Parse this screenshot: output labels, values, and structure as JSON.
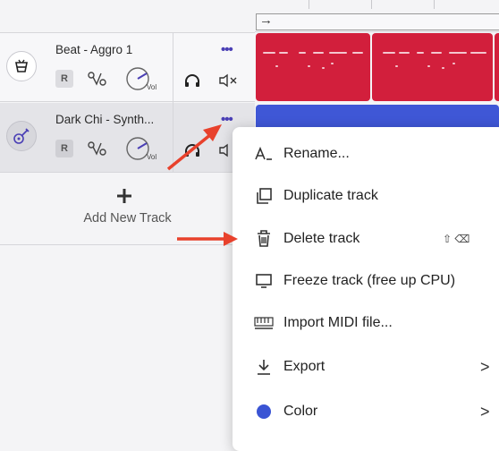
{
  "tracks": [
    {
      "name": "Beat - Aggro 1",
      "record_label": "R",
      "volume_label": "Vol",
      "menu_label": "•••",
      "icon": "drum-machine-icon"
    },
    {
      "name": "Dark Chi - Synth...",
      "record_label": "R",
      "volume_label": "Vol",
      "menu_label": "•••",
      "icon": "guitar-icon"
    }
  ],
  "add_track": {
    "label": "Add New Track",
    "icon": "plus-icon"
  },
  "timeline": {
    "loop_arrow": "→"
  },
  "context_menu": {
    "items": [
      {
        "label": "Rename...",
        "icon": "rename-icon"
      },
      {
        "label": "Duplicate track",
        "icon": "duplicate-icon"
      },
      {
        "label": "Delete track",
        "icon": "trash-icon",
        "shortcut": "⇧ ⌫"
      },
      {
        "label": "Freeze track (free up CPU)",
        "icon": "monitor-icon"
      },
      {
        "label": "Import MIDI file...",
        "icon": "midi-icon"
      },
      {
        "label": "Export",
        "icon": "download-icon",
        "chevron": ">"
      },
      {
        "label": "Color",
        "icon": "color-dot-icon",
        "chevron": ">",
        "color": "#3a54d4"
      }
    ]
  },
  "colors": {
    "accent": "#4a3fb5",
    "track1_clip": "#d21f3c",
    "track2_clip": "#3f57d6",
    "annotation_arrow": "#e8412c"
  }
}
